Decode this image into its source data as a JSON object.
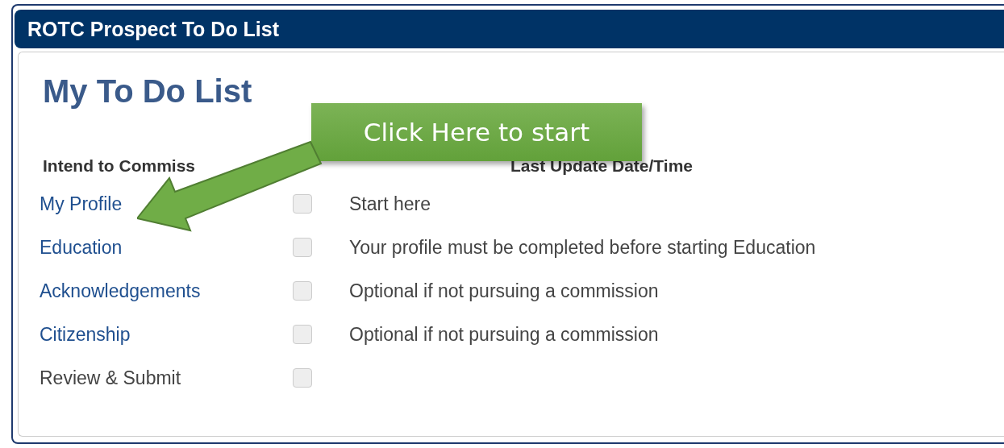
{
  "window": {
    "title": "ROTC Prospect To Do List"
  },
  "heading": "My To Do List",
  "columns": [
    "Intend to Commiss",
    "Last Update Date/Time"
  ],
  "rows": [
    {
      "label": "My Profile",
      "disabled": false,
      "checked": false,
      "note": "Start here"
    },
    {
      "label": "Education",
      "disabled": false,
      "checked": false,
      "note": "Your profile must be completed before starting Education"
    },
    {
      "label": "Acknowledgements",
      "disabled": false,
      "checked": false,
      "note": "Optional if not pursuing a commission"
    },
    {
      "label": "Citizenship",
      "disabled": false,
      "checked": false,
      "note": "Optional if not pursuing a commission"
    },
    {
      "label": "Review & Submit",
      "disabled": true,
      "checked": false
    }
  ],
  "callout": {
    "text": "Click Here to start"
  }
}
